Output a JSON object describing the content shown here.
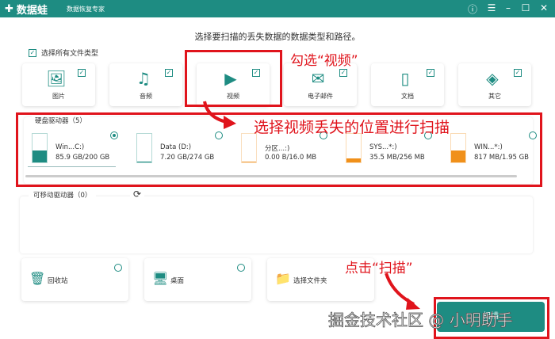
{
  "header": {
    "app_name": "数据蛙",
    "subtitle": "数据恢复专家"
  },
  "title": "选择要扫描的丢失数据的数据类型和路径。",
  "select_all": {
    "label": "选择所有文件类型",
    "checked": true
  },
  "file_types": [
    {
      "label": "图片",
      "icon": "image-icon",
      "checked": true
    },
    {
      "label": "音频",
      "icon": "music-icon",
      "checked": true
    },
    {
      "label": "视频",
      "icon": "video-icon",
      "checked": true
    },
    {
      "label": "电子邮件",
      "icon": "email-icon",
      "checked": true
    },
    {
      "label": "文档",
      "icon": "document-icon",
      "checked": true
    },
    {
      "label": "其它",
      "icon": "other-icon",
      "checked": true
    }
  ],
  "hard_drives": {
    "label": "硬盘驱动器（5）",
    "items": [
      {
        "name": "Win...C:)",
        "size": "85.9 GB/200 GB",
        "used": 0.43,
        "color": "#1e8c82",
        "selected": true
      },
      {
        "name": "Data (D:)",
        "size": "7.20 GB/274 GB",
        "used": 0.03,
        "color": "#1e8c82",
        "selected": false
      },
      {
        "name": "分区...:)",
        "size": "0.00  B/16.0 MB",
        "used": 0,
        "color": "#f0a040",
        "selected": false
      },
      {
        "name": "SYS...*:)",
        "size": "35.5 MB/256 MB",
        "used": 0.14,
        "color": "#f0901a",
        "selected": false
      },
      {
        "name": "WIN...*:)",
        "size": "817 MB/1.95 GB",
        "used": 0.42,
        "color": "#f0901a",
        "selected": false
      }
    ]
  },
  "removable": {
    "label": "可移动驱动器（0）"
  },
  "locations": [
    {
      "label": "回收站",
      "icon": "recycle-bin-icon"
    },
    {
      "label": "桌面",
      "icon": "desktop-icon"
    },
    {
      "label": "选择文件夹",
      "icon": "folder-icon"
    }
  ],
  "scan_button": "扫描",
  "annotations": {
    "video": "勾选“视频”",
    "location": "选择视频丢失的位置进行扫描",
    "scan": "点击“扫描”"
  },
  "watermark": "掘金技术社区 @ 小明助手",
  "colors": {
    "brand": "#1e8c82",
    "annotation": "#e0141c"
  }
}
